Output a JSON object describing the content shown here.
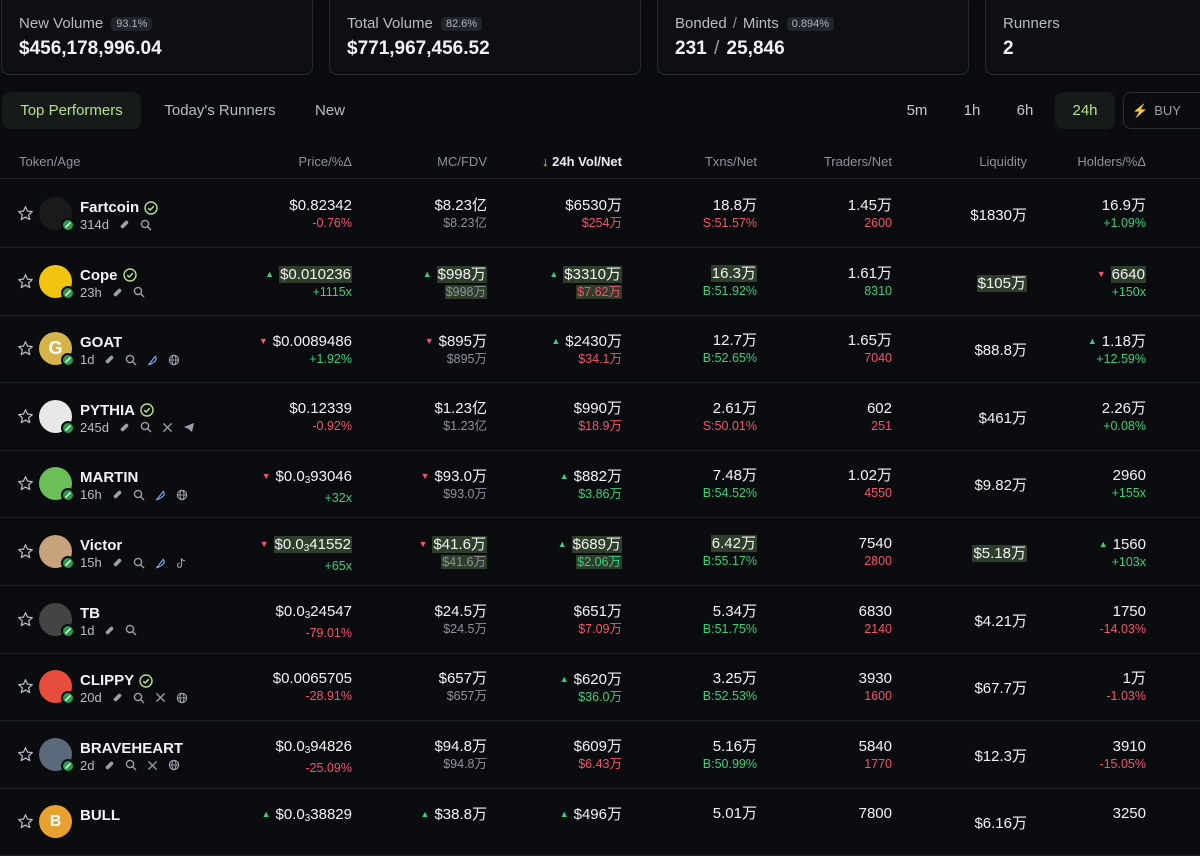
{
  "stats": {
    "new_volume": {
      "label": "New Volume",
      "pct": "93.1%",
      "value": "$456,178,996.04"
    },
    "total_volume": {
      "label": "Total Volume",
      "pct": "82.6%",
      "value": "$771,967,456.52"
    },
    "bonded": {
      "label_a": "Bonded",
      "slash": "/",
      "label_b": "Mints",
      "pct": "0.894%",
      "bonded": "231",
      "slash2": "/",
      "mints": "25,846"
    },
    "runners": {
      "label": "Runners",
      "value": "2"
    }
  },
  "tabs": [
    "Top Performers",
    "Today's Runners",
    "New"
  ],
  "timeframes": [
    "5m",
    "1h",
    "6h",
    "24h"
  ],
  "buy_label": "BUY",
  "headers": {
    "token": "Token/Age",
    "price": "Price/%Δ",
    "mc": "MC/FDV",
    "vol": "24h Vol/Net",
    "vol_arrow": "↓",
    "txns": "Txns/Net",
    "traders": "Traders/Net",
    "liq": "Liquidity",
    "holders": "Holders/%Δ"
  },
  "colors": {
    "accent": "#c7e26b",
    "up": "#39d07b",
    "down": "#f2556d",
    "bg": "#0b0c10"
  },
  "rows": [
    {
      "name": "Fartcoin",
      "verified": true,
      "age": "314d",
      "icons": [
        "pill-icon",
        "search-icon"
      ],
      "price": "$0.82342",
      "price_pct": "-0.76%",
      "mc": "$8.23亿",
      "fdv": "$8.23亿",
      "vol": "$6530万",
      "vol_net": "$254万",
      "txns": "18.8万",
      "txns_net": "S:51.57%",
      "traders": "1.45万",
      "traders_net": "2600",
      "liq": "$1830万",
      "holders": "16.9万",
      "holders_pct": "+1.09%"
    },
    {
      "name": "Cope",
      "verified": true,
      "age": "23h",
      "icons": [
        "pill-icon",
        "search-icon"
      ],
      "price": "$0.010236",
      "price_pct": "+1115x",
      "mc": "$998万",
      "fdv": "$998万",
      "vol": "$3310万",
      "vol_net": "$7.62万",
      "txns": "16.3万",
      "txns_net": "B:51.92%",
      "traders": "1.61万",
      "traders_net": "8310",
      "liq": "$105万",
      "holders": "6640",
      "holders_pct": "+150x"
    },
    {
      "name": "GOAT",
      "verified": false,
      "age": "1d",
      "icons": [
        "pill-icon",
        "search-icon",
        "feather-icon",
        "globe-icon"
      ],
      "price": "$0.0089486",
      "price_pct": "+1.92%",
      "mc": "$895万",
      "fdv": "$895万",
      "vol": "$2430万",
      "vol_net": "$34.1万",
      "txns": "12.7万",
      "txns_net": "B:52.65%",
      "traders": "1.65万",
      "traders_net": "7040",
      "liq": "$88.8万",
      "holders": "1.18万",
      "holders_pct": "+12.59%"
    },
    {
      "name": "PYTHIA",
      "verified": true,
      "age": "245d",
      "icons": [
        "pill-icon",
        "search-icon",
        "x-icon",
        "telegram-icon"
      ],
      "price": "$0.12339",
      "price_pct": "-0.92%",
      "mc": "$1.23亿",
      "fdv": "$1.23亿",
      "vol": "$990万",
      "vol_net": "$18.9万",
      "txns": "2.61万",
      "txns_net": "S:50.01%",
      "traders": "602",
      "traders_net": "251",
      "liq": "$461万",
      "holders": "2.26万",
      "holders_pct": "+0.08%"
    },
    {
      "name": "MARTIN",
      "verified": false,
      "age": "16h",
      "icons": [
        "pill-icon",
        "search-icon",
        "feather-icon",
        "globe-icon"
      ],
      "price_a": "$0.0",
      "price_sub": "3",
      "price_b": "93046",
      "price_pct": "+32x",
      "mc": "$93.0万",
      "fdv": "$93.0万",
      "vol": "$882万",
      "vol_net": "$3.86万",
      "txns": "7.48万",
      "txns_net": "B:54.52%",
      "traders": "1.02万",
      "traders_net": "4550",
      "liq": "$9.82万",
      "holders": "2960",
      "holders_pct": "+155x"
    },
    {
      "name": "Victor",
      "verified": false,
      "age": "15h",
      "icons": [
        "pill-icon",
        "search-icon",
        "feather-icon",
        "tiktok-icon"
      ],
      "price_a": "$0.0",
      "price_sub": "3",
      "price_b": "41552",
      "price_pct": "+65x",
      "mc": "$41.6万",
      "fdv": "$41.6万",
      "vol": "$689万",
      "vol_net": "$2.06万",
      "txns": "6.42万",
      "txns_net": "B:55.17%",
      "traders": "7540",
      "traders_net": "2800",
      "liq": "$5.18万",
      "holders": "1560",
      "holders_pct": "+103x"
    },
    {
      "name": "TB",
      "verified": false,
      "age": "1d",
      "icons": [
        "pill-icon",
        "search-icon"
      ],
      "price_a": "$0.0",
      "price_sub": "3",
      "price_b": "24547",
      "price_pct": "-79.01%",
      "mc": "$24.5万",
      "fdv": "$24.5万",
      "vol": "$651万",
      "vol_net": "$7.09万",
      "txns": "5.34万",
      "txns_net": "B:51.75%",
      "traders": "6830",
      "traders_net": "2140",
      "liq": "$4.21万",
      "holders": "1750",
      "holders_pct": "-14.03%"
    },
    {
      "name": "CLIPPY",
      "verified": true,
      "age": "20d",
      "icons": [
        "pill-icon",
        "search-icon",
        "x-icon",
        "globe-icon"
      ],
      "price": "$0.0065705",
      "price_pct": "-28.91%",
      "mc": "$657万",
      "fdv": "$657万",
      "vol": "$620万",
      "vol_net": "$36.0万",
      "txns": "3.25万",
      "txns_net": "B:52.53%",
      "traders": "3930",
      "traders_net": "1600",
      "liq": "$67.7万",
      "holders": "1万",
      "holders_pct": "-1.03%"
    },
    {
      "name": "BRAVEHEART",
      "verified": false,
      "age": "2d",
      "icons": [
        "pill-icon",
        "search-icon",
        "x-icon",
        "globe-icon"
      ],
      "price_a": "$0.0",
      "price_sub": "3",
      "price_b": "94826",
      "price_pct": "-25.09%",
      "mc": "$94.8万",
      "fdv": "$94.8万",
      "vol": "$609万",
      "vol_net": "$6.43万",
      "txns": "5.16万",
      "txns_net": "B:50.99%",
      "traders": "5840",
      "traders_net": "1770",
      "liq": "$12.3万",
      "holders": "3910",
      "holders_pct": "-15.05%"
    },
    {
      "name": "BULL",
      "verified": false,
      "age": "",
      "icons": [],
      "price_a": "$0.0",
      "price_sub": "3",
      "price_b": "38829",
      "price_pct": "",
      "mc": "$38.8万",
      "fdv": "",
      "vol": "$496万",
      "vol_net": "",
      "txns": "5.01万",
      "txns_net": "",
      "traders": "7800",
      "traders_net": "",
      "liq": "$6.16万",
      "holders": "3250",
      "holders_pct": ""
    }
  ]
}
